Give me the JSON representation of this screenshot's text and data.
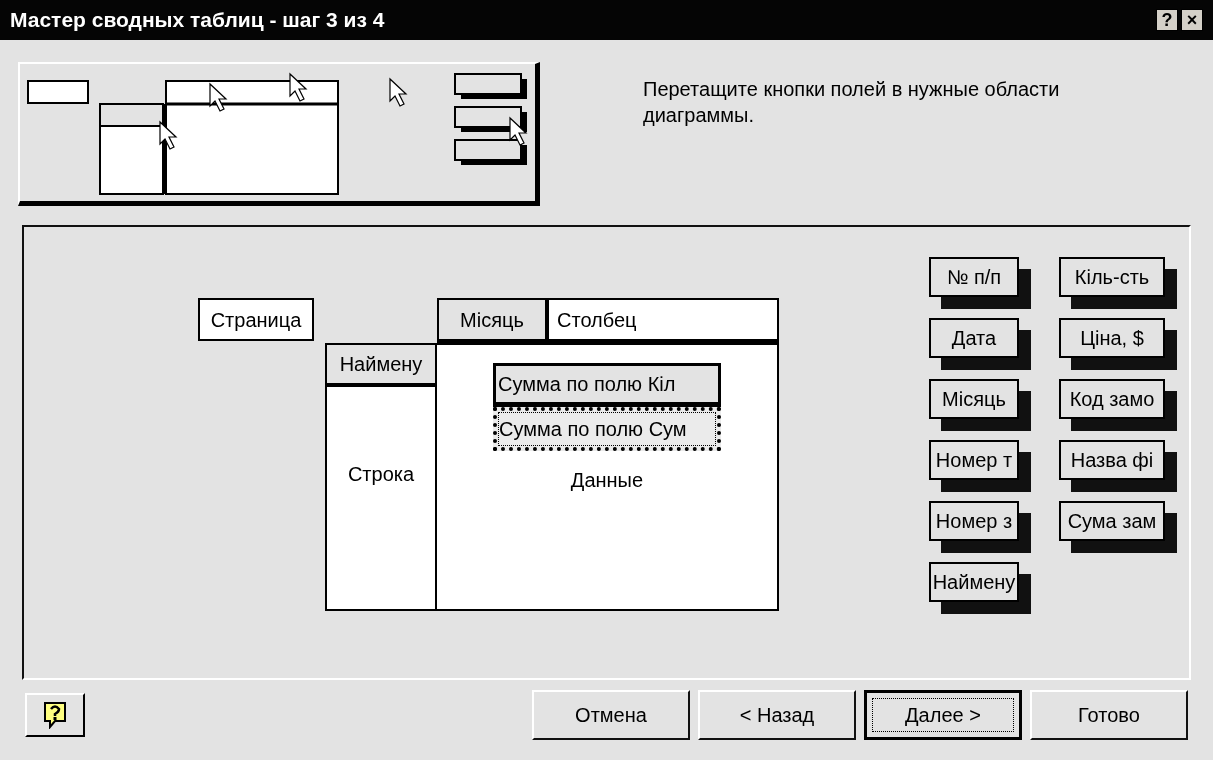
{
  "window": {
    "title": "Мастер сводных таблиц - шаг 3 из 4",
    "controls": [
      "?",
      "×"
    ]
  },
  "instruction": "Перетащите кнопки полей в нужные области диаграммы.",
  "layout": {
    "page": {
      "label": "Страница"
    },
    "column": {
      "label": "Столбец",
      "fields": [
        "Місяць"
      ]
    },
    "row": {
      "label": "Строка",
      "fields": [
        "Наймену"
      ]
    },
    "data": {
      "label": "Данные",
      "fields": [
        {
          "label": "Сумма по полю  Кіл",
          "focused": false
        },
        {
          "label": "Сумма по полю Сум",
          "focused": true
        }
      ]
    }
  },
  "fields": [
    "№ п/п",
    "Кіль-сть",
    "Дата",
    "Ціна, $",
    "Місяць",
    "Код замо",
    "Номер т",
    "Назва фі",
    "Номер з",
    "Сума зам",
    "Наймену"
  ],
  "buttons": [
    {
      "label": "Отмена",
      "default": false
    },
    {
      "label": "< Назад",
      "default": false
    },
    {
      "label": "Далее >",
      "default": true
    },
    {
      "label": "Готово",
      "default": false
    }
  ]
}
